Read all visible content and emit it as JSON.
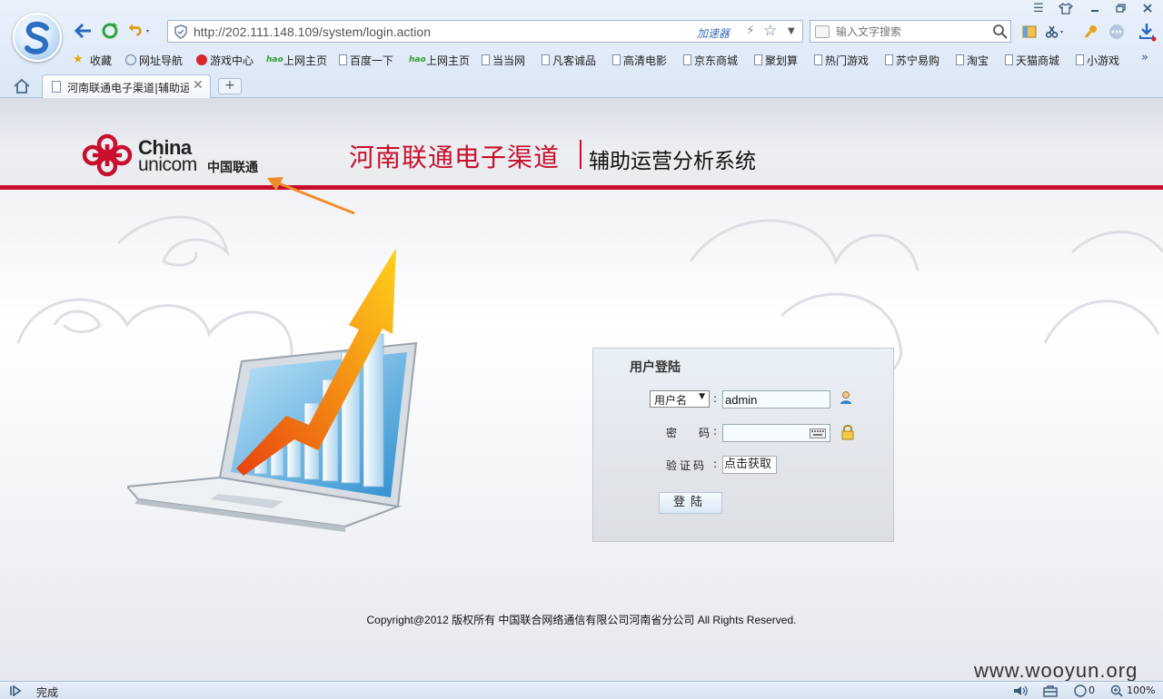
{
  "browser": {
    "address_url": "http://202.111.148.109/system/login.action",
    "accelerator_label": "加速器",
    "search_placeholder": "输入文字搜索",
    "bookmarks": [
      "收藏",
      "网址导航",
      "游戏中心",
      "上网主页",
      "百度一下",
      "上网主页",
      "当当网",
      "凡客诚品",
      "高清电影",
      "京东商城",
      "聚划算",
      "热门游戏",
      "苏宁易购",
      "淘宝",
      "天猫商城",
      "小游戏"
    ],
    "tab_title": "河南联通电子渠道|辅助运营分析系统",
    "new_tab_label": "+",
    "status_text": "完成",
    "blocked_count": "0",
    "zoom": "100%"
  },
  "header": {
    "logo_text_line1": "China",
    "logo_text_line2": "unicom",
    "logo_text_cn": "中国联通",
    "title_red": "河南联通电子渠道",
    "title_black": "辅助运营分析系统"
  },
  "login": {
    "title": "用户登陆",
    "user_type_selected": "用户名",
    "username_value": "admin",
    "password_label": "密　　码",
    "captcha_label": "验证码",
    "captcha_button": "点击获取",
    "submit_label": "登陆"
  },
  "footer": {
    "copyright": "Copyright@2012 版权所有 中国联合网络通信有限公司河南省分公司 All Rights Reserved."
  },
  "watermark": "www.wooyun.org",
  "colors": {
    "brand_red": "#c8102e",
    "chrome_blue": "#dbe7f5"
  }
}
